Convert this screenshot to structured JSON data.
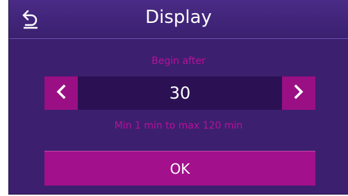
{
  "header": {
    "title": "Display",
    "back_icon": "undo-arrow-icon"
  },
  "setting": {
    "label": "Begin after",
    "value": "30",
    "range_text": "Min 1 min to max 120 min",
    "decrement_icon": "chevron-left-icon",
    "increment_icon": "chevron-right-icon"
  },
  "actions": {
    "ok_label": "OK"
  },
  "colors": {
    "background": "#3d1f6f",
    "header": "#4a2b86",
    "accent": "#a3108c",
    "label": "#b8109a",
    "value_field": "#2b1153"
  }
}
